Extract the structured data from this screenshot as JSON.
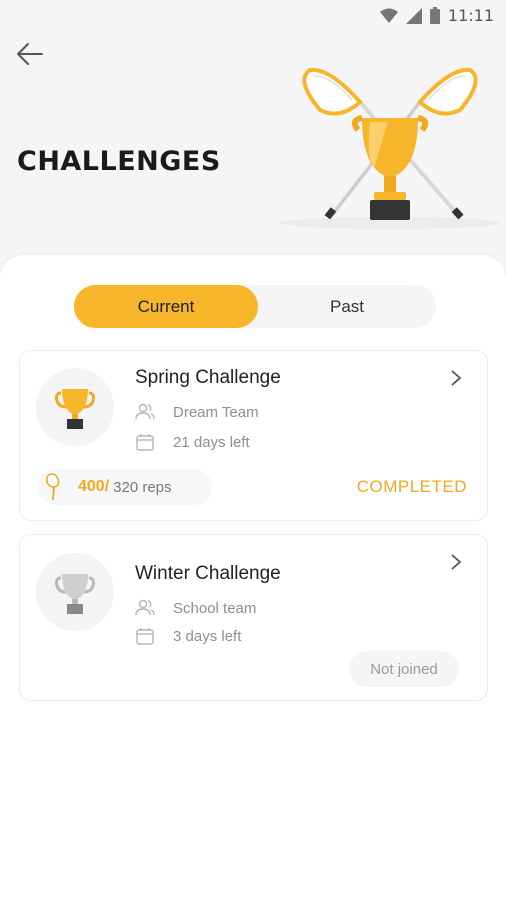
{
  "status_bar": {
    "time": "11:11"
  },
  "header": {
    "title": "CHALLENGES"
  },
  "tabs": [
    {
      "label": "Current",
      "active": true
    },
    {
      "label": "Past",
      "active": false
    }
  ],
  "challenges": [
    {
      "title": "Spring Challenge",
      "team": "Dream Team",
      "time_left": "21 days left",
      "reps_done": "400/",
      "reps_total": "320 reps",
      "status": "COMPLETED",
      "trophy": "gold-trophy-icon"
    },
    {
      "title": "Winter Challenge",
      "team": "School team",
      "time_left": "3 days left",
      "status": "Not joined",
      "trophy": "silver-trophy-icon"
    }
  ],
  "colors": {
    "accent": "#f7b52a",
    "accent_text": "#f2a81f",
    "background": "#f5f5f7"
  }
}
